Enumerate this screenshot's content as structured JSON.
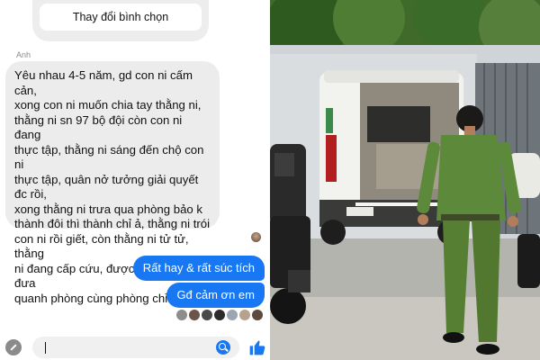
{
  "poll": {
    "change_vote_label": "Thay đổi bình chọn"
  },
  "message": {
    "sender": "Anh",
    "text": "Yêu nhau 4-5 năm, gd con ni cấm cản,\nxong con ni muốn chia tay thằng ni,\nthằng ni sn 97 bộ đội còn con ni đang\nthực tập, thằng ni sáng đến chộ con ni\nthực tập, quân nở tưởng giải quyết đc rồi,\nxong thằng  ni trưa qua phòng bảo k\nthành đôi thì thành chỉ ả, thằng ni trói\ncon ni rồi giết, còn thằng ni tử tử, thằng\nni đang cấp cứu, được bạn hay mấy đưa\nquanh phòng cùng phòng chỉ gọi ả"
  },
  "replies": [
    {
      "text": "Rất hay & rất súc tích"
    },
    {
      "text": "Gđ cảm ơn em"
    }
  ],
  "composer": {
    "value": "",
    "placeholder": ""
  },
  "colors": {
    "messenger_blue": "#1877f2",
    "bubble_gray": "#ececec",
    "police_uniform": "#5d8a3a"
  },
  "icons": {
    "left": "pencil-circle-icon",
    "search": "search-icon",
    "like": "thumbs-up-icon"
  }
}
